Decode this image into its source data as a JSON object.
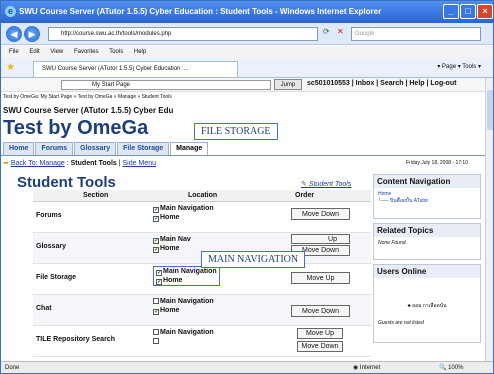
{
  "window": {
    "title": "SWU Course Server (ATutor 1.5.5) Cyber Education : Student Tools - Windows Internet Explorer",
    "min": "_",
    "max": "□",
    "close": "×"
  },
  "address": {
    "url": "http://course.swu.ac.th/tools/modules.php",
    "search_placeholder": "Google"
  },
  "menu": [
    "File",
    "Edit",
    "View",
    "Favorites",
    "Tools",
    "Help"
  ],
  "tab": {
    "label": "SWU Course Server (ATutor 1.5.5) Cyber Education :...",
    "tools": "▾ Page ▾ Tools ▾"
  },
  "page": {
    "start_select": "My Start Page",
    "jump_label": "Jump",
    "user_links": "sc501010553 | Inbox | Search | Help | Log-out",
    "breadcrumb": "Test by OmeGa: My Start Page » Test by OmeGa » Manage » Student Tools",
    "course_server": "SWU Course Server (ATutor 1.5.5) Cyber Edu",
    "course_title": "Test by OmeGa",
    "nav_tabs": [
      "Home",
      "Forums",
      "Glossary",
      "File Storage",
      "Manage"
    ],
    "back_link": "Back To: Manage",
    "current_crumb": "Student Tools",
    "side_menu": "Side Menu",
    "date": "Friday July 18, 2008 - 17:10",
    "heading": "Student Tools",
    "student_tools_link": "Student Tools"
  },
  "table": {
    "headers": {
      "section": "Section",
      "location": "Location",
      "order": "Order"
    },
    "rows": [
      {
        "section": "Forums",
        "main_nav": "Main Navigation",
        "home": "Home",
        "btn1": "Move Down",
        "btn2": ""
      },
      {
        "section": "Glossary",
        "main_nav": "Main Nav",
        "home": "Home",
        "btn1": "Up",
        "btn2": "Move Down"
      },
      {
        "section": "File Storage",
        "main_nav": "Main Navigation",
        "home": "Home",
        "btn1": "Move Up",
        "btn2": ""
      },
      {
        "section": "Chat",
        "main_nav": "Main Navigation",
        "home": "Home",
        "btn1": "Move Down",
        "btn2": ""
      },
      {
        "section": "TILE Repository Search",
        "main_nav": "Main Navigation",
        "home": "",
        "btn1": "Move Up",
        "btn2": "Move Down"
      }
    ]
  },
  "sidebar": {
    "content_nav": {
      "title": "Content Navigation",
      "line1": "Home",
      "line2": "└── ปิ่นตื้อยปั้น ATutor"
    },
    "related": {
      "title": "Related Topics",
      "text": "None Found."
    },
    "users_online": {
      "title": "Users Online",
      "user": "ออม กาเลือดนั่น",
      "text": "Guests are not listed"
    }
  },
  "callouts": {
    "file_storage": "FILE STORAGE",
    "main_navigation": "MAIN NAVIGATION"
  },
  "status": {
    "done": "Done",
    "zone": "Internet",
    "zoom": "100%"
  }
}
